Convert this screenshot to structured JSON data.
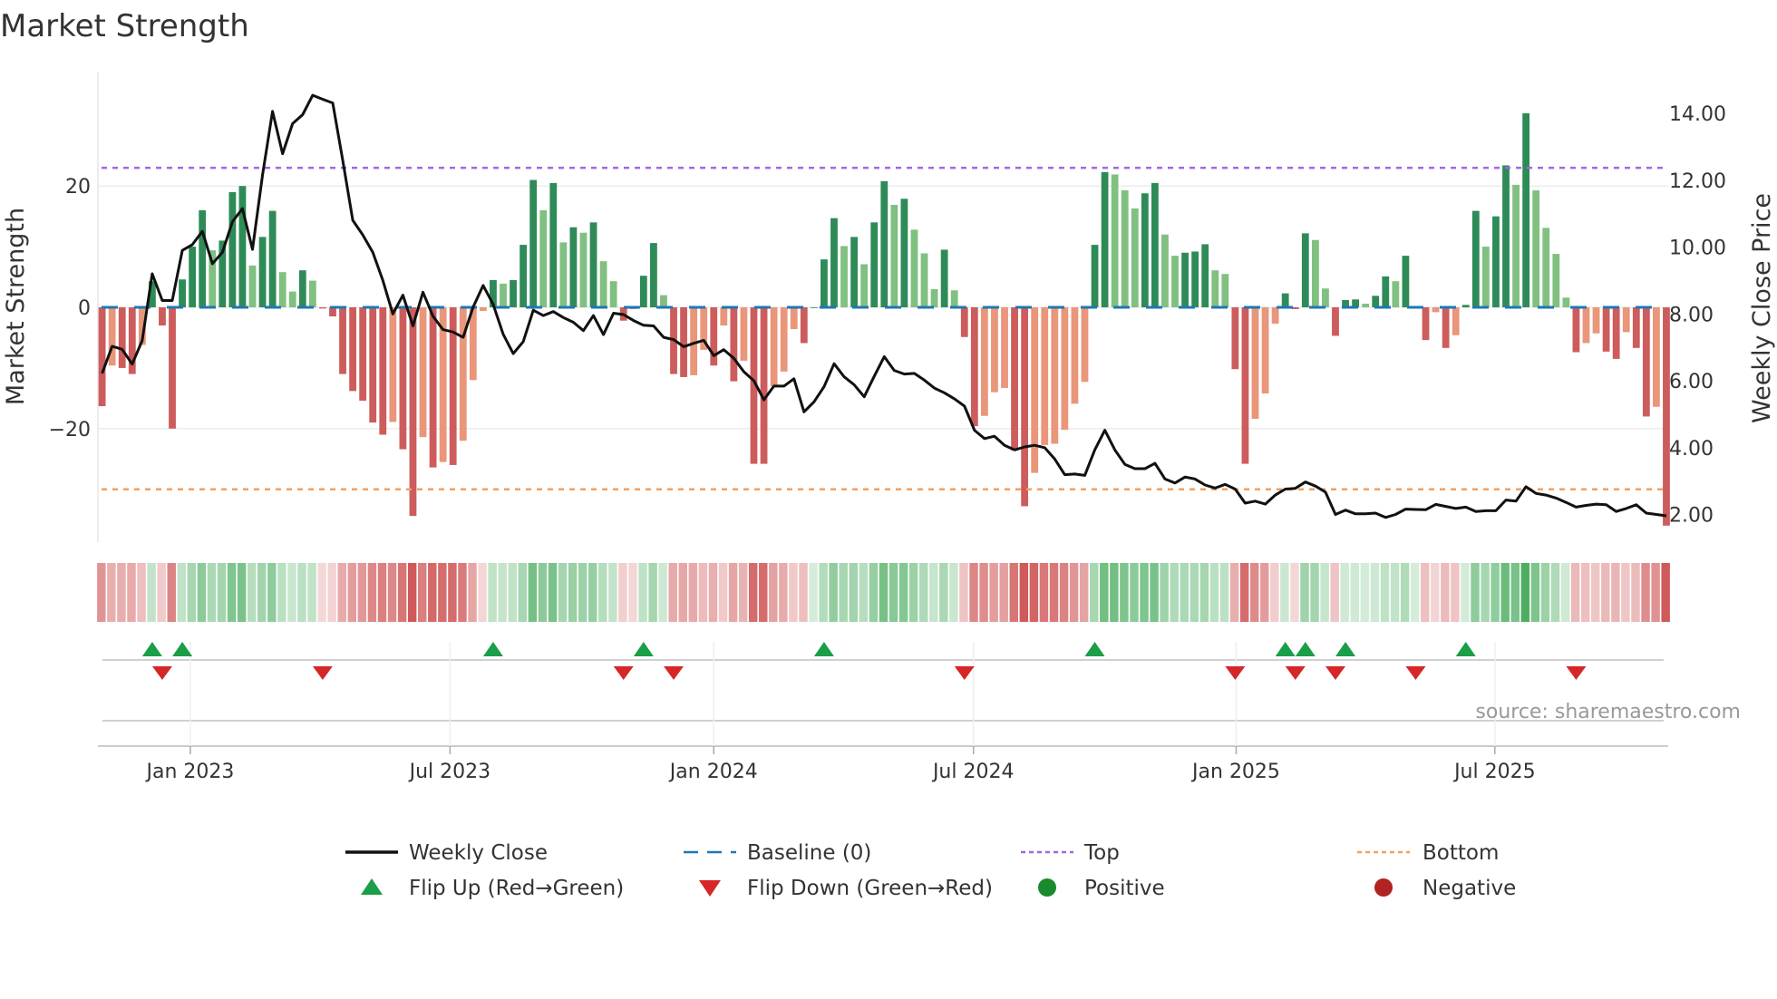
{
  "title": "Market Strength",
  "source": "source: sharemaestro.com",
  "colors": {
    "strong_up": "#2e8b57",
    "weak_up": "#80c080",
    "strong_down": "#cd5c5c",
    "weak_down": "#e9967a",
    "line": "#111111",
    "baseline": "#1f77b4",
    "top": "#a366e0",
    "bottom": "#f0a060",
    "flip_up": "#1a9e48",
    "flip_down": "#d62728",
    "positive": "#1a8a2e",
    "negative": "#b22222"
  },
  "chart_data": {
    "type": "bar+line",
    "title": "Market Strength",
    "ylabel": "Market Strength",
    "y2label": "Weekly Close Price",
    "ylim": [
      -38,
      38.5
    ],
    "y2lim": [
      1.55,
      14.9
    ],
    "y_ticks": [
      {
        "v": 20,
        "label": "20"
      },
      {
        "v": 0,
        "label": "0"
      },
      {
        "v": -20,
        "label": "−20"
      }
    ],
    "y2_ticks": [
      {
        "v": 2,
        "label": "2.00"
      },
      {
        "v": 4,
        "label": "4.00"
      },
      {
        "v": 6,
        "label": "6.00"
      },
      {
        "v": 8,
        "label": "8.00"
      },
      {
        "v": 10,
        "label": "10.00"
      },
      {
        "v": 12,
        "label": "12.00"
      },
      {
        "v": 14,
        "label": "14.00"
      }
    ],
    "x_ticks": [
      {
        "week": 8.8,
        "label": "Jan 2023"
      },
      {
        "week": 34.7,
        "label": "Jul 2023"
      },
      {
        "week": 61.0,
        "label": "Jan 2024"
      },
      {
        "week": 86.9,
        "label": "Jul 2024"
      },
      {
        "week": 113.1,
        "label": "Jan 2025"
      },
      {
        "week": 138.9,
        "label": "Jul 2025"
      }
    ],
    "top_level": 23,
    "bottom_level": -30,
    "baseline": 0,
    "strength": [
      -16.3,
      -9.6,
      -10,
      -11,
      -6.2,
      4.3,
      -3,
      -20,
      4.6,
      10,
      16,
      9.4,
      11,
      19,
      20,
      6.9,
      11.6,
      15.9,
      5.8,
      2.6,
      6.1,
      4.4,
      -0.2,
      -1.5,
      -11,
      -13.8,
      -15.4,
      -19,
      -21,
      -18.9,
      -23.4,
      -34.4,
      -21.4,
      -26.4,
      -25.5,
      -26,
      -22,
      -12,
      -0.6,
      4.5,
      3.9,
      4.5,
      10.3,
      21,
      16,
      20.5,
      10.7,
      13.2,
      12.3,
      14,
      7.6,
      4.3,
      -2.2,
      -0.3,
      5.2,
      10.6,
      2,
      -11,
      -11.5,
      -11.2,
      -7,
      -9.6,
      -3,
      -12.2,
      -8.8,
      -25.8,
      -25.8,
      -13,
      -10.6,
      -3.6,
      -5.9,
      0,
      7.9,
      14.7,
      10.1,
      11.6,
      7.1,
      14,
      20.8,
      16.9,
      17.9,
      12.8,
      8.9,
      3,
      9.5,
      2.8,
      -4.9,
      -19.6,
      -17.9,
      -14,
      -13.3,
      -23.6,
      -32.8,
      -27.3,
      -22.7,
      -22.5,
      -20.2,
      -15.9,
      -12.3,
      10.3,
      22.3,
      21.9,
      19.3,
      16.3,
      18.8,
      20.5,
      12,
      8.5,
      9,
      9.2,
      10.4,
      6.1,
      5.5,
      -10.2,
      -25.8,
      -18.4,
      -14.2,
      -2.7,
      2.3,
      -0.3,
      12.2,
      11.1,
      3.1,
      -4.7,
      1.2,
      1.3,
      0.6,
      1.9,
      5.1,
      4.3,
      8.5,
      0,
      -5.4,
      -0.8,
      -6.7,
      -4.6,
      0.4,
      15.9,
      10,
      15,
      23.4,
      20.2,
      32,
      19.3,
      13.1,
      8.8,
      1.6,
      -7.4,
      -5.9,
      -4.3,
      -7.3,
      -8.5,
      -4.1,
      -6.7,
      -18,
      -16.4,
      -36
    ],
    "weekly_close": [
      6.22,
      7.03,
      6.94,
      6.5,
      7.2,
      9.2,
      8.4,
      8.4,
      9.9,
      10.07,
      10.47,
      9.5,
      9.84,
      10.76,
      11.15,
      9.93,
      12.16,
      14.06,
      12.79,
      13.69,
      13.96,
      14.54,
      14.42,
      14.31,
      12.6,
      10.8,
      10.36,
      9.84,
      9.0,
      8.0,
      8.56,
      7.64,
      8.65,
      7.93,
      7.53,
      7.46,
      7.3,
      8.2,
      8.85,
      8.29,
      7.39,
      6.81,
      7.17,
      8.11,
      7.95,
      8.07,
      7.89,
      7.75,
      7.5,
      7.95,
      7.38,
      8.02,
      7.98,
      7.8,
      7.66,
      7.64,
      7.3,
      7.23,
      7.02,
      7.12,
      7.21,
      6.75,
      6.93,
      6.67,
      6.27,
      6.0,
      5.43,
      5.84,
      5.84,
      6.06,
      5.07,
      5.37,
      5.82,
      6.51,
      6.12,
      5.88,
      5.52,
      6.13,
      6.72,
      6.31,
      6.2,
      6.22,
      6.02,
      5.78,
      5.64,
      5.46,
      5.24,
      4.52,
      4.27,
      4.34,
      4.07,
      3.93,
      4.02,
      4.07,
      4.0,
      3.66,
      3.19,
      3.21,
      3.17,
      3.93,
      4.52,
      3.93,
      3.5,
      3.37,
      3.37,
      3.53,
      3.06,
      2.94,
      3.12,
      3.06,
      2.88,
      2.79,
      2.9,
      2.76,
      2.34,
      2.4,
      2.31,
      2.58,
      2.76,
      2.78,
      2.97,
      2.85,
      2.67,
      2.0,
      2.13,
      2.02,
      2.02,
      2.04,
      1.91,
      2.0,
      2.16,
      2.15,
      2.14,
      2.3,
      2.24,
      2.18,
      2.22,
      2.09,
      2.11,
      2.11,
      2.43,
      2.4,
      2.83,
      2.63,
      2.58,
      2.49,
      2.36,
      2.22,
      2.27,
      2.31,
      2.29,
      2.09,
      2.18,
      2.29,
      2.04,
      2.0,
      1.96
    ],
    "flip_up_weeks": [
      5,
      8,
      39,
      54,
      72,
      99,
      118,
      120,
      124,
      136
    ],
    "flip_down_weeks": [
      6,
      22,
      52,
      57,
      86,
      113,
      119,
      123,
      131,
      147
    ],
    "legend": {
      "placement": "bottom",
      "items": [
        {
          "label": "Weekly Close",
          "kind": "line"
        },
        {
          "label": "Baseline (0)",
          "kind": "baseline"
        },
        {
          "label": "Top",
          "kind": "top"
        },
        {
          "label": "Bottom",
          "kind": "bottom"
        },
        {
          "label": "Flip Up (Red→Green)",
          "kind": "flip_up"
        },
        {
          "label": "Flip Down (Green→Red)",
          "kind": "flip_down"
        },
        {
          "label": "Positive",
          "kind": "positive"
        },
        {
          "label": "Negative",
          "kind": "negative"
        }
      ]
    }
  }
}
